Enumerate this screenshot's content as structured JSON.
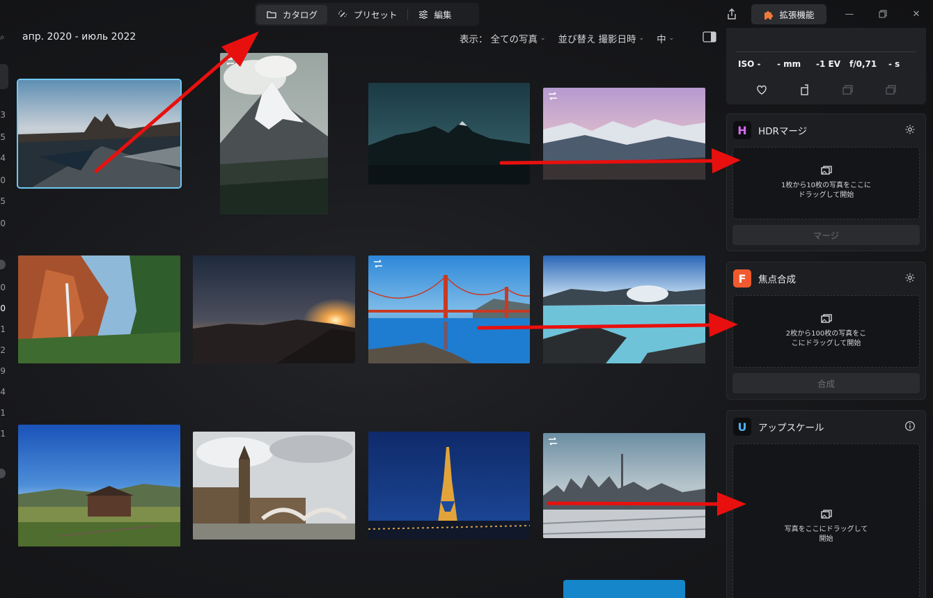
{
  "tabs": [
    {
      "label": "カタログ",
      "icon": "folder-icon",
      "active": true
    },
    {
      "label": "プリセット",
      "icon": "magic-wand-icon",
      "active": false
    },
    {
      "label": "編集",
      "icon": "sliders-icon",
      "active": false
    }
  ],
  "toolbar": {
    "extensions_label": "拡張機能",
    "share_icon": "share-icon"
  },
  "window_controls": [
    "minimize-icon",
    "restore-icon",
    "close-icon"
  ],
  "catalog": {
    "date_range": "апр. 2020 - июль 2022",
    "view_label": "表示：",
    "view_value": "全ての写真",
    "sort_label": "並び替え",
    "sort_value": "撮影日時",
    "size_value": "中"
  },
  "left_strip": {
    "numbers": [
      "3",
      "5",
      "4",
      "0",
      "5",
      "0",
      "0",
      "0",
      "1",
      "2",
      "9",
      "4",
      "1",
      "1"
    ],
    "active_index": 7
  },
  "photos": [
    {
      "name": "photo-rocky-shore",
      "selected": true,
      "edited": false
    },
    {
      "name": "photo-matterhorn",
      "selected": false,
      "edited": true
    },
    {
      "name": "photo-mountain-night",
      "selected": false,
      "edited": false
    },
    {
      "name": "photo-alpine-lake",
      "selected": false,
      "edited": true
    },
    {
      "name": "photo-canyon-waterfall",
      "selected": false,
      "edited": false
    },
    {
      "name": "photo-sunset-hills",
      "selected": false,
      "edited": false
    },
    {
      "name": "photo-golden-gate",
      "selected": false,
      "edited": true
    },
    {
      "name": "photo-blue-lagoon",
      "selected": false,
      "edited": false
    },
    {
      "name": "photo-barn-field",
      "selected": false,
      "edited": false
    },
    {
      "name": "photo-big-ben",
      "selected": false,
      "edited": false
    },
    {
      "name": "photo-eiffel-tower",
      "selected": false,
      "edited": false
    },
    {
      "name": "photo-toronto-skyline",
      "selected": false,
      "edited": true
    }
  ],
  "info_panel": {
    "exif": {
      "iso": "ISO -",
      "focal": "- mm",
      "ev": "-1 EV",
      "aperture": "f/0,71",
      "shutter": "- s"
    }
  },
  "tools": {
    "hdr": {
      "title": "HDRマージ",
      "logo_letter": "H",
      "logo_color": "#c35bf0",
      "drop_text": "1枚から10枚の写真をここにドラッグして開始",
      "button": "マージ"
    },
    "focus": {
      "title": "焦点合成",
      "logo_letter": "F",
      "logo_color": "#f0683a",
      "drop_text": "2枚から100枚の写真をここにドラッグして開始",
      "button": "合成"
    },
    "upscale": {
      "title": "アップスケール",
      "logo_letter": "U",
      "logo_color": "#3ba9f0",
      "drop_text": "写真をここにドラッグして開始"
    }
  },
  "colors": {
    "accent": "#6fc9f2",
    "annotation_arrow": "#e8100e",
    "primary_button": "#1486c9"
  }
}
